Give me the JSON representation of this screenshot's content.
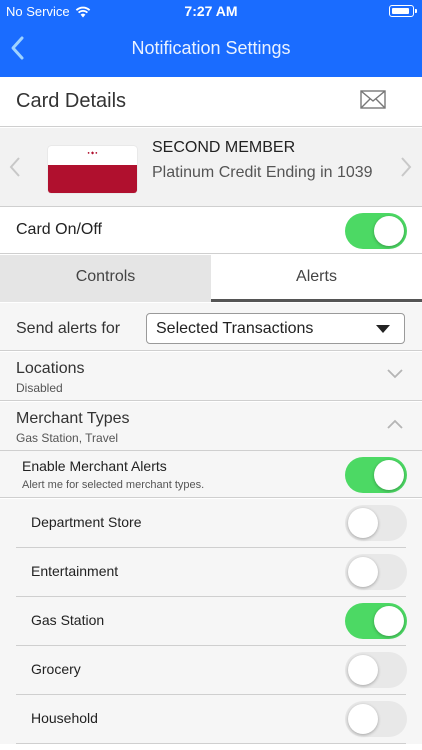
{
  "status": {
    "carrier": "No Service",
    "time": "7:27 AM"
  },
  "nav": {
    "title": "Notification Settings"
  },
  "card_details": {
    "title": "Card Details"
  },
  "card": {
    "member": "SECOND MEMBER",
    "description": "Platinum Credit Ending in 1039"
  },
  "card_onoff": {
    "label": "Card On/Off",
    "on": true
  },
  "tabs": [
    {
      "label": "Controls"
    },
    {
      "label": "Alerts"
    }
  ],
  "send_alerts": {
    "label": "Send alerts for",
    "value": "Selected Transactions"
  },
  "locations": {
    "title": "Locations",
    "sub": "Disabled"
  },
  "merchant_types": {
    "title": "Merchant Types",
    "sub": "Gas Station, Travel"
  },
  "enable_merchant": {
    "title": "Enable Merchant Alerts",
    "sub": "Alert me for selected merchant types.",
    "on": true
  },
  "merchants": [
    {
      "label": "Department Store",
      "on": false
    },
    {
      "label": "Entertainment",
      "on": false
    },
    {
      "label": "Gas Station",
      "on": true
    },
    {
      "label": "Grocery",
      "on": false
    },
    {
      "label": "Household",
      "on": false
    }
  ],
  "colors": {
    "nav": "#1a6cff",
    "toggle_on": "#4cd964",
    "card_red": "#b0102e"
  }
}
